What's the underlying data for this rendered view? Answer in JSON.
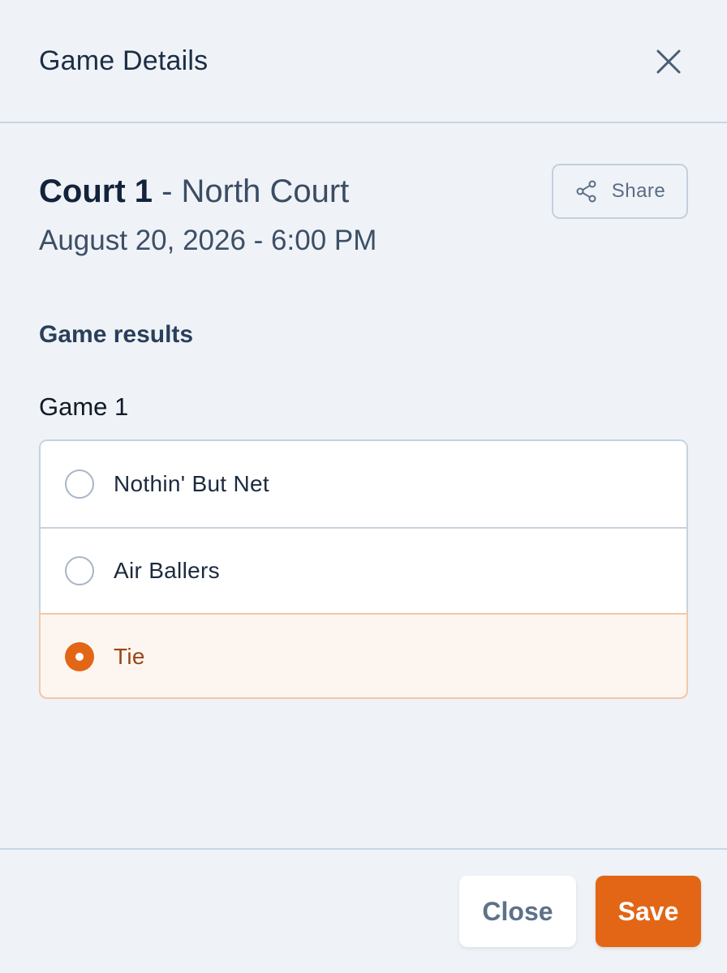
{
  "header": {
    "title": "Game Details",
    "close_icon": "close-icon"
  },
  "event": {
    "court_name": "Court 1",
    "court_separator": " - ",
    "court_location": "North Court",
    "datetime": "August 20, 2026 - 6:00 PM"
  },
  "share": {
    "label": "Share",
    "icon": "share-icon"
  },
  "results": {
    "section_title": "Game results",
    "game_label": "Game 1",
    "options": [
      {
        "label": "Nothin' But Net",
        "selected": false
      },
      {
        "label": "Air Ballers",
        "selected": false
      },
      {
        "label": "Tie",
        "selected": true
      }
    ]
  },
  "footer": {
    "close_label": "Close",
    "save_label": "Save"
  },
  "colors": {
    "accent": "#e26616",
    "selected_bg": "#fdf6f0",
    "selected_text": "#9a4513",
    "background": "#eff3f7"
  }
}
